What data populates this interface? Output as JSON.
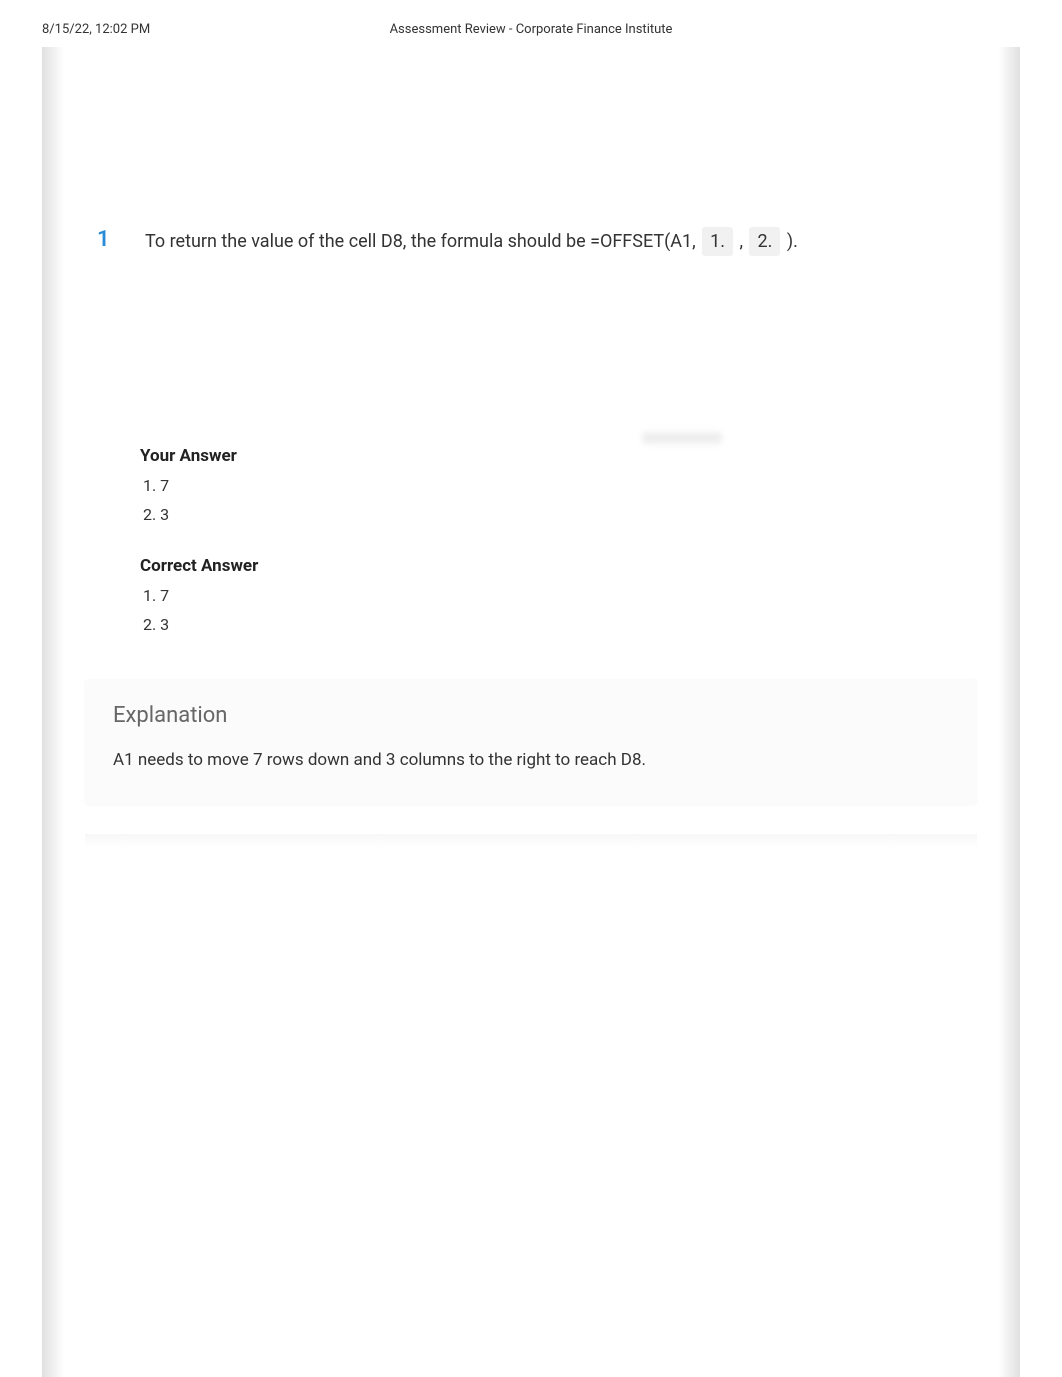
{
  "header": {
    "timestamp": "8/15/22, 12:02 PM",
    "title": "Assessment Review - Corporate Finance Institute"
  },
  "question": {
    "number": "1",
    "text_part1": "To return the value of the cell D8, the formula should be =OFFSET(A1, ",
    "blank1": "1.",
    "separator": " , ",
    "blank2": "2.",
    "text_part2": " )."
  },
  "your_answer": {
    "heading": "Your Answer",
    "items": [
      "1. 7",
      "2. 3"
    ]
  },
  "correct_answer": {
    "heading": "Correct Answer",
    "items": [
      "1. 7",
      "2. 3"
    ]
  },
  "explanation": {
    "title": "Explanation",
    "text": "A1 needs to move 7 rows down and 3 columns to the right to reach D8."
  }
}
